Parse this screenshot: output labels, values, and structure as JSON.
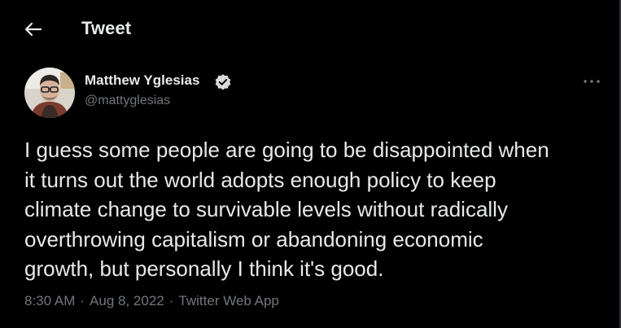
{
  "header": {
    "back_icon": "arrow-left-icon",
    "title": "Tweet"
  },
  "tweet": {
    "author": {
      "name": "Matthew Yglesias",
      "handle": "@mattyglesias",
      "verified_icon": "verified-badge-icon",
      "avatar_icon": "avatar-photo"
    },
    "more_icon": "more-options-icon",
    "text_lines": [
      "I guess some people are going to be disappointed when",
      "it turns out the world adopts enough policy to keep",
      "climate change to survivable levels without radically",
      "overthrowing capitalism or abandoning economic",
      "growth, but personally I think it's good."
    ],
    "time": "8:30 AM",
    "separator": "·",
    "date": "Aug 8, 2022",
    "source": "Twitter Web App"
  },
  "colors": {
    "background": "#000000",
    "primary_text": "#e7e9ea",
    "secondary_text": "#71767b",
    "verified_badge": "#d9d9d9"
  }
}
